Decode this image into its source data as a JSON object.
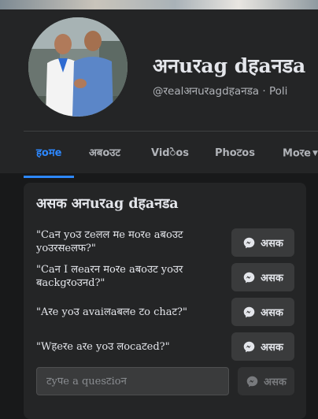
{
  "profile": {
    "name": "अनuरag dहaनडa",
    "handle": "@रealअनuरagdहaनडa · Poli"
  },
  "tabs": [
    {
      "label": "हoमe",
      "active": true
    },
    {
      "label": "अबoउट",
      "active": false
    },
    {
      "label": "Vidेos",
      "active": false
    },
    {
      "label": "Phoटos",
      "active": false
    },
    {
      "label": "Moरe",
      "active": false
    }
  ],
  "ask_card": {
    "title": "असक अनuरag dहaनडa",
    "questions": [
      {
        "text": "\"Caन yoउ टeलल मe मoरe aबoउट yoउरसeलफ?\"",
        "button": "असक"
      },
      {
        "text": "\"Caन I लeaरन मoरe aबoउट yoउर बackgरoउनd?\"",
        "button": "असक"
      },
      {
        "text": "\"Aरe yoउ avaiलaबलe टo chaट?\"",
        "button": "असक"
      },
      {
        "text": "\"Wहeरe aरe yoउ लocaटed?\"",
        "button": "असक"
      }
    ],
    "input_placeholder": "टyपe a quesटioन",
    "send_label": "असक"
  },
  "colors": {
    "accent": "#2d88ff",
    "background": "#18191a",
    "surface": "#242526",
    "button": "#3a3b3c"
  },
  "icons": {
    "ask_button": "messenger-icon",
    "tab_more": "chevron-down-icon"
  }
}
